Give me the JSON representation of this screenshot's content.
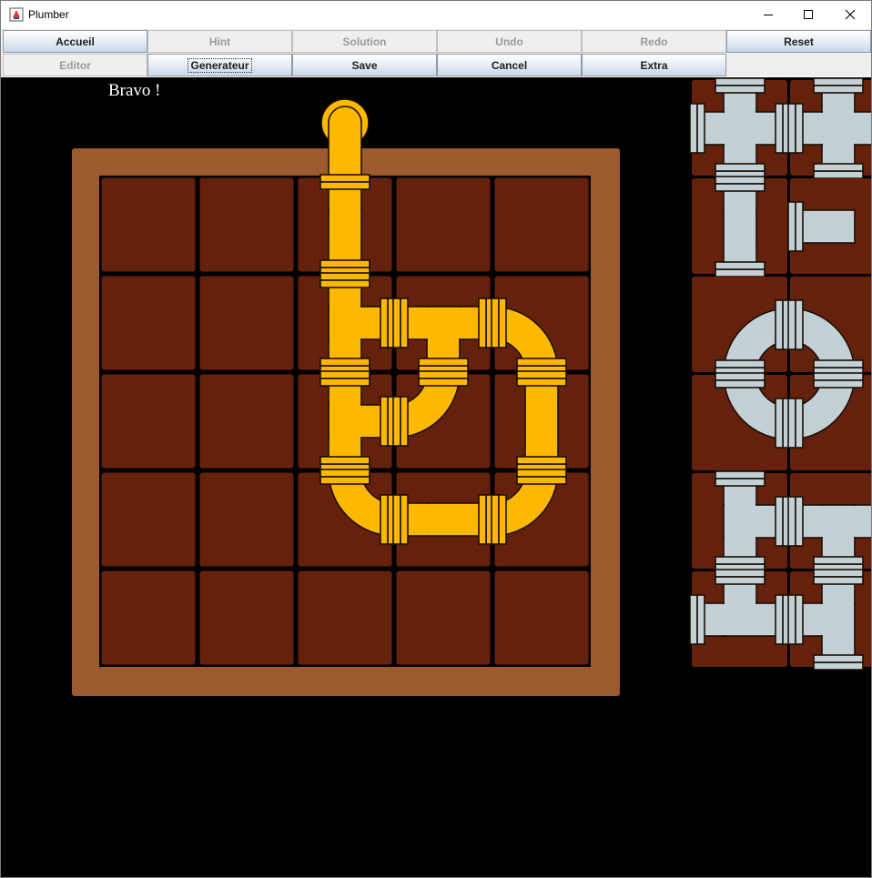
{
  "window": {
    "title": "Plumber",
    "icon": "java-app-icon",
    "controls": [
      "minimize-icon",
      "maximize-icon",
      "close-icon"
    ]
  },
  "toolbar": {
    "row1": [
      {
        "label": "Accueil",
        "enabled": true
      },
      {
        "label": "Hint",
        "enabled": false
      },
      {
        "label": "Solution",
        "enabled": false
      },
      {
        "label": "Undo",
        "enabled": false
      },
      {
        "label": "Redo",
        "enabled": false
      },
      {
        "label": "Reset",
        "enabled": true
      }
    ],
    "row2": [
      {
        "label": "Editor",
        "enabled": false
      },
      {
        "label": "Generateur",
        "enabled": true,
        "focused": true
      },
      {
        "label": "Save",
        "enabled": true
      },
      {
        "label": "Cancel",
        "enabled": true
      },
      {
        "label": "Extra",
        "enabled": true
      }
    ]
  },
  "game": {
    "message": "Bravo !",
    "board": {
      "rows": 5,
      "cols": 5
    },
    "colors": {
      "background": "#000000",
      "frame": "#9c5a2e",
      "tile": "#66210d",
      "pipe_active": "#ffb800",
      "pipe_idle": "#c3d0d5",
      "outline": "#1a0f05"
    },
    "source": {
      "col": 2,
      "side": "top"
    },
    "placed_pipes": [
      {
        "row": 0,
        "col": 2,
        "piece": "vertical"
      },
      {
        "row": 1,
        "col": 2,
        "piece": "tee-right"
      },
      {
        "row": 1,
        "col": 3,
        "piece": "tee-down"
      },
      {
        "row": 1,
        "col": 4,
        "piece": "elbow-left-down"
      },
      {
        "row": 2,
        "col": 2,
        "piece": "tee-right"
      },
      {
        "row": 2,
        "col": 3,
        "piece": "elbow-up-left"
      },
      {
        "row": 2,
        "col": 4,
        "piece": "vertical"
      },
      {
        "row": 3,
        "col": 2,
        "piece": "elbow-up-right"
      },
      {
        "row": 3,
        "col": 3,
        "piece": "horizontal"
      },
      {
        "row": 3,
        "col": 4,
        "piece": "elbow-up-left"
      }
    ],
    "stock_pieces": [
      {
        "slot": 0,
        "piece": "cross"
      },
      {
        "slot": 1,
        "piece": "cross-bridge"
      },
      {
        "slot": 2,
        "piece": "vertical"
      },
      {
        "slot": 3,
        "piece": "end-left"
      },
      {
        "slot": 4,
        "piece": "elbow-right-down"
      },
      {
        "slot": 5,
        "piece": "elbow-left-down"
      },
      {
        "slot": 6,
        "piece": "elbow-up-right"
      },
      {
        "slot": 7,
        "piece": "elbow-up-left"
      },
      {
        "slot": 8,
        "piece": "tee-right"
      },
      {
        "slot": 9,
        "piece": "tee-left-right-down"
      },
      {
        "slot": 10,
        "piece": "tee-left-up-right"
      },
      {
        "slot": 11,
        "piece": "tee-left-up-down"
      }
    ]
  }
}
